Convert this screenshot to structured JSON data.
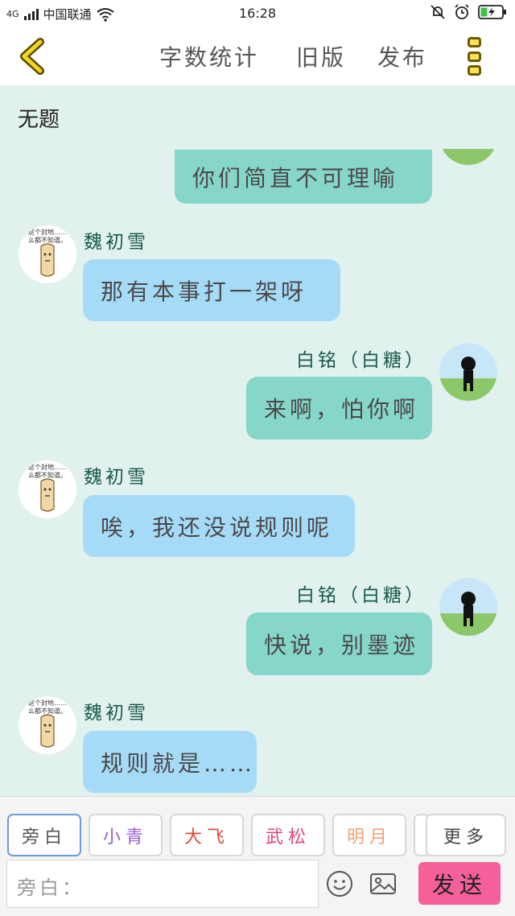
{
  "status_bar": {
    "network": "4G",
    "carrier": "中国联通",
    "time": "16:28",
    "icons": [
      "signal-icon",
      "wifi-icon",
      "mute-bell-icon",
      "alarm-icon",
      "battery-charging-icon"
    ]
  },
  "header": {
    "back_icon": "chevron-left-icon",
    "word_count": "字数统计",
    "old_version": "旧版",
    "publish": "发布",
    "more_icon": "more-vertical-icon"
  },
  "document": {
    "title": "无题"
  },
  "messages": [
    {
      "side": "mine",
      "sender": "",
      "text": "你们简直不可理喻"
    },
    {
      "side": "theirs",
      "sender": "魏初雪",
      "text": "那有本事打一架呀"
    },
    {
      "side": "mine",
      "sender": "白铭（白糖）",
      "text": "来啊，怕你啊"
    },
    {
      "side": "theirs",
      "sender": "魏初雪",
      "text": "唉，我还没说规则呢"
    },
    {
      "side": "mine",
      "sender": "白铭（白糖）",
      "text": "快说，别墨迹"
    },
    {
      "side": "theirs",
      "sender": "魏初雪",
      "text": "规则就是……"
    }
  ],
  "avatar_meme_text": [
    "这个封地……",
    "么都不知道。"
  ],
  "roles": [
    {
      "label": "旁白",
      "color": "#555555",
      "selected": true
    },
    {
      "label": "小青",
      "color": "#9b5fd0"
    },
    {
      "label": "大飞",
      "color": "#e0483a"
    },
    {
      "label": "武松",
      "color": "#e0477a"
    },
    {
      "label": "明月",
      "color": "#f0a070"
    },
    {
      "label": "更多",
      "color": "#444444"
    }
  ],
  "composer": {
    "placeholder": "旁白：",
    "emoji_icon": "emoji-icon",
    "image_icon": "image-icon",
    "send_label": "发送"
  },
  "colors": {
    "background": "#e0f1ee",
    "my_bubble": "#86d6c9",
    "their_bubble": "#a6dbf7",
    "send_button": "#f5609a",
    "back_arrow": "#f2d42a"
  }
}
